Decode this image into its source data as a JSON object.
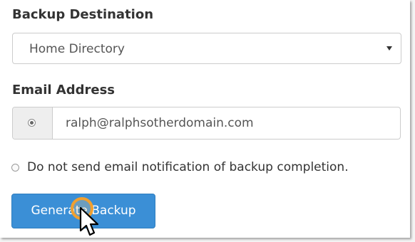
{
  "backup_destination": {
    "label": "Backup Destination",
    "selected": "Home Directory"
  },
  "email": {
    "label": "Email Address",
    "value": "ralph@ralphsotherdomain.com"
  },
  "notification_option": {
    "label": "Do not send email notification of backup completion."
  },
  "actions": {
    "generate_label": "Generate Backup"
  },
  "colors": {
    "button": "#3b8fd6",
    "highlight": "#f0a030"
  }
}
